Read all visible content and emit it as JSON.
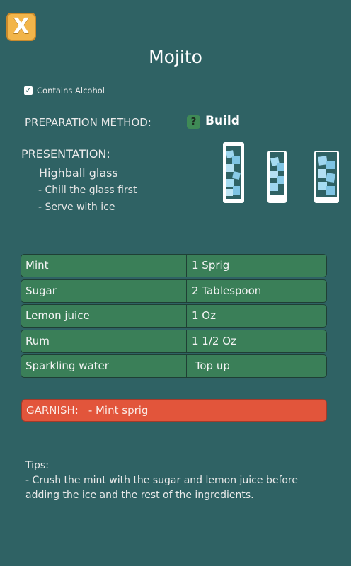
{
  "close_button": {
    "label": "X"
  },
  "title": "Mojito",
  "contains_alcohol": {
    "label": "Contains Alcohol",
    "checked": true
  },
  "preparation": {
    "label": "PREPARATION METHOD:",
    "help_icon": "?",
    "method": "Build"
  },
  "presentation": {
    "label": "PRESENTATION:",
    "glass": "Highball glass",
    "notes": [
      "- Chill the glass first",
      "- Serve with ice"
    ]
  },
  "glass_icons": [
    "highball-glass-icon",
    "rocks-glass-icon",
    "collins-glass-icon"
  ],
  "ingredients": [
    {
      "name": "Mint",
      "amount": "1 Sprig"
    },
    {
      "name": "Sugar",
      "amount": "2 Tablespoon"
    },
    {
      "name": "Lemon juice",
      "amount": "1 Oz"
    },
    {
      "name": "Rum",
      "amount": "1 1/2 Oz"
    },
    {
      "name": "Sparkling water",
      "amount": " Top up"
    }
  ],
  "garnish": {
    "label": "GARNISH:",
    "value": "- Mint sprig"
  },
  "tips": {
    "label": "Tips:",
    "text": "- Crush the mint with the sugar and lemon juice before adding the ice and the rest of the ingredients."
  },
  "colors": {
    "background": "#2f6264",
    "ingredient_row": "#3a7f58",
    "garnish": "#e2553b",
    "close_button": "#f2b54a"
  }
}
